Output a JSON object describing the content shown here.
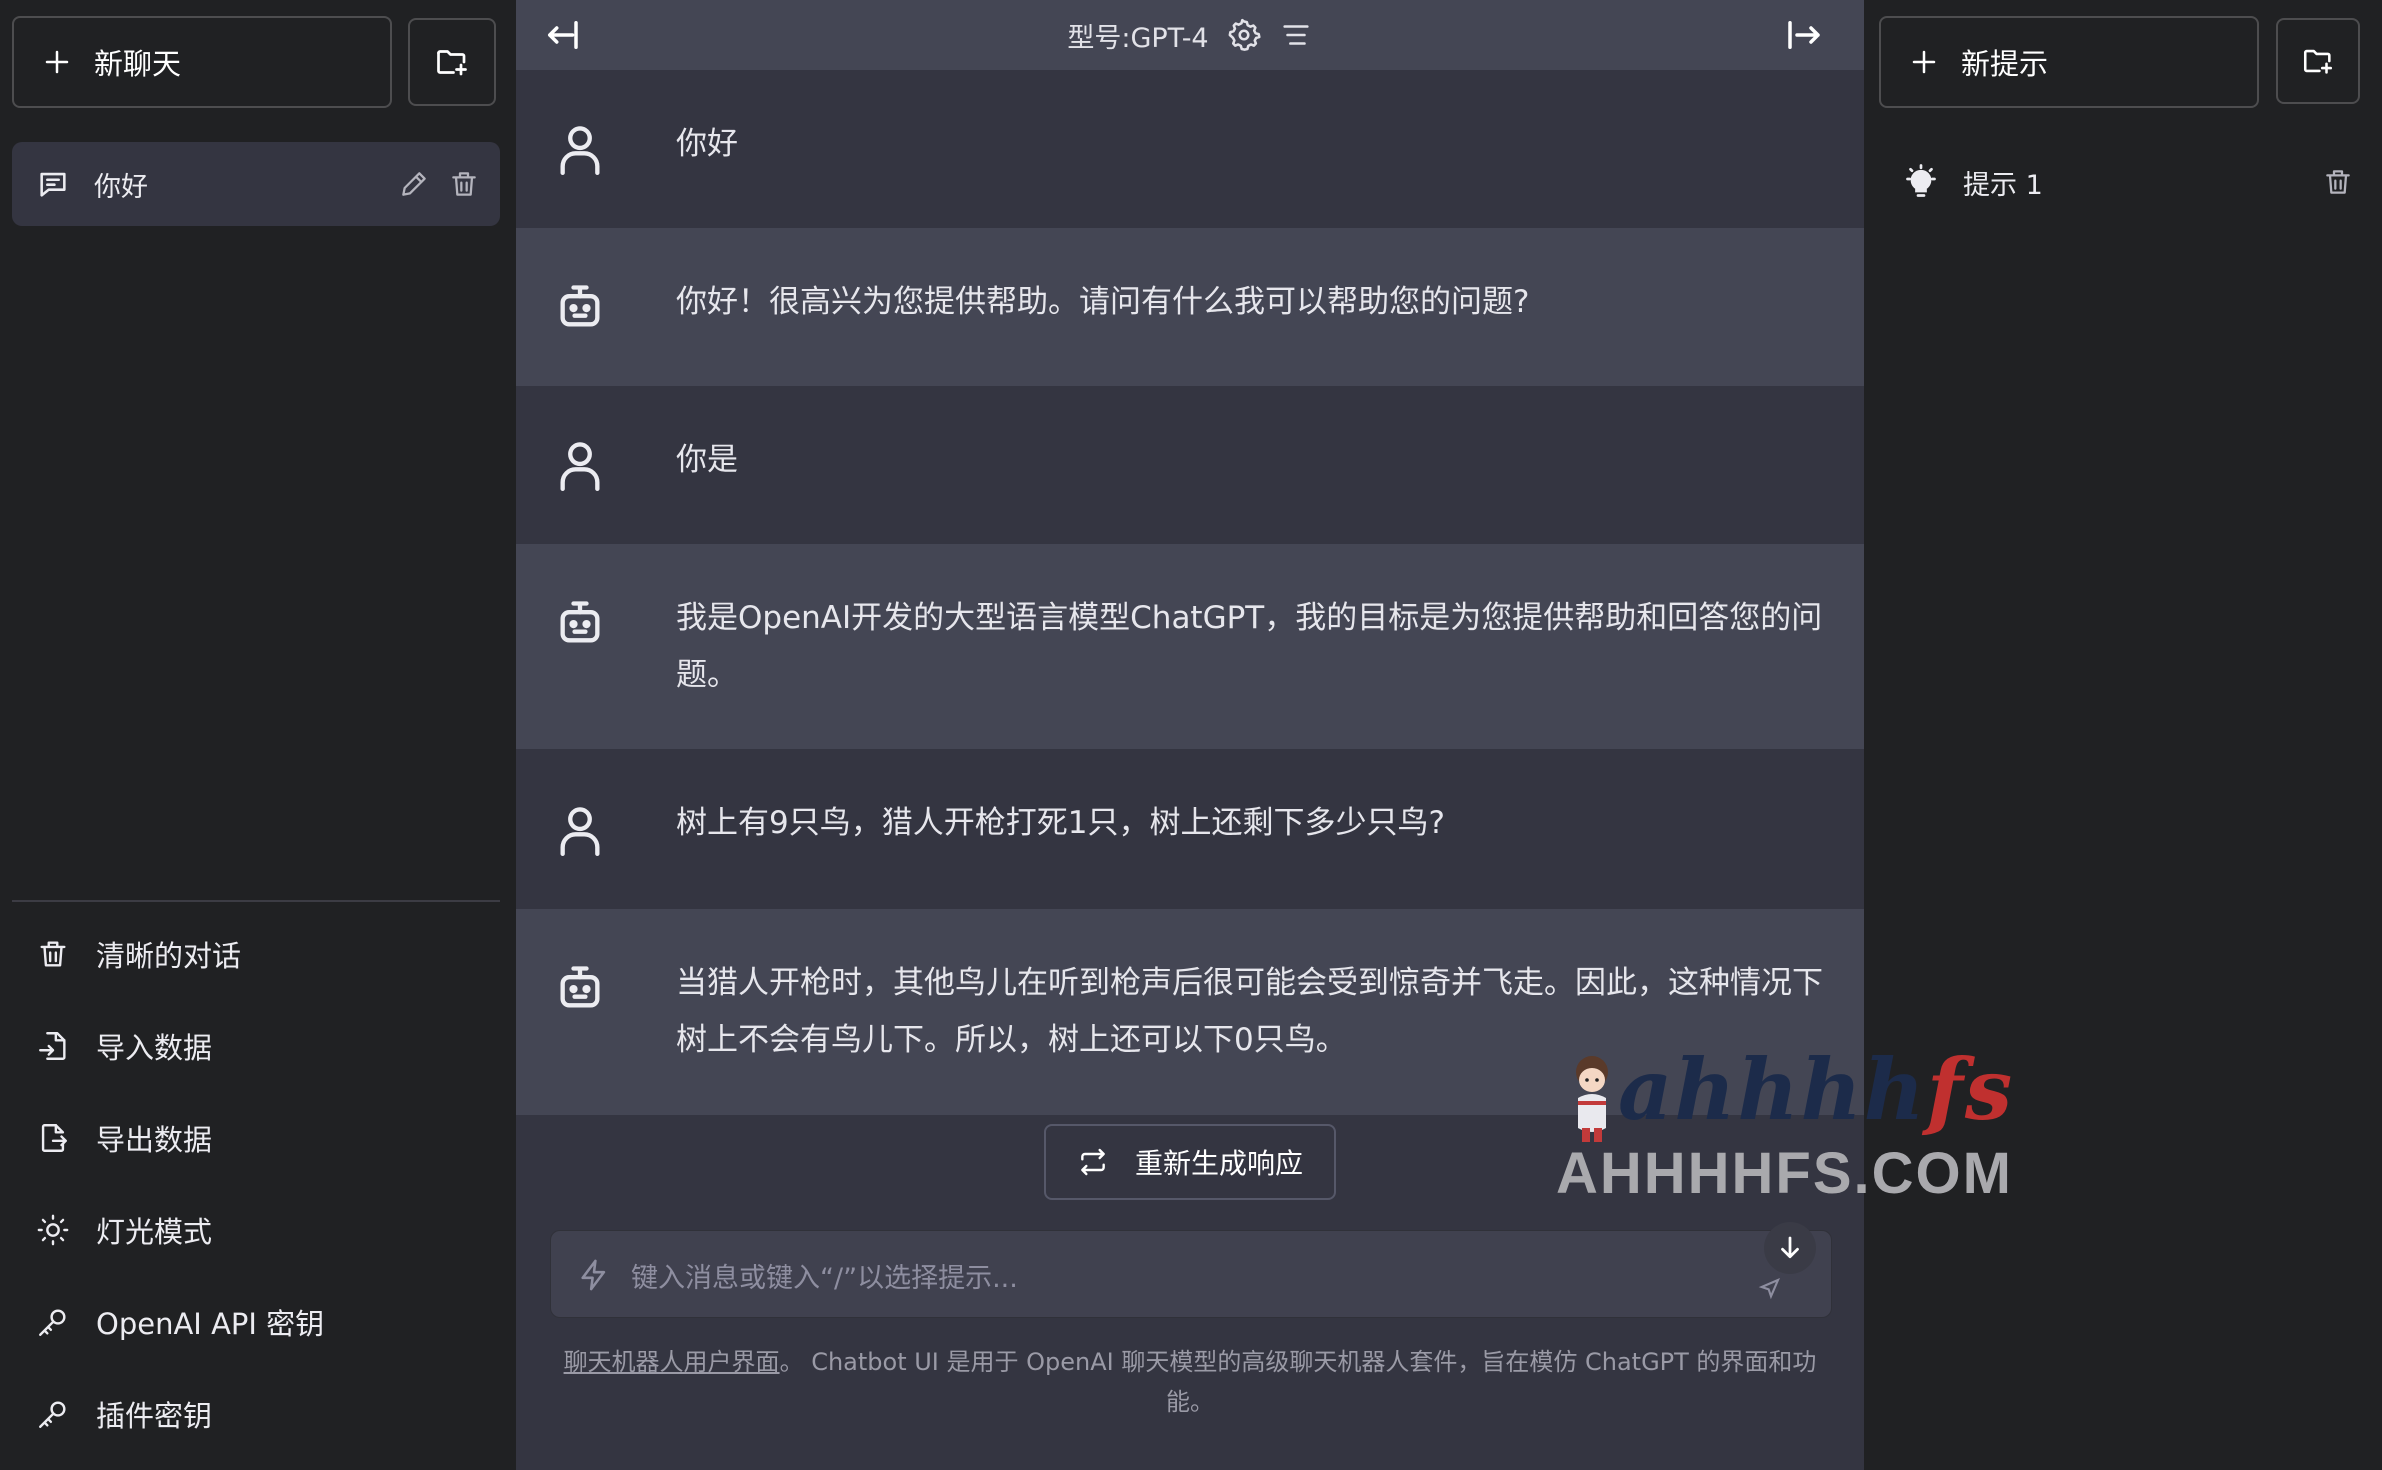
{
  "left_sidebar": {
    "new_chat_label": "新聊天",
    "conversations": [
      {
        "label": "你好"
      }
    ],
    "menu": [
      {
        "label": "清晰的对话",
        "icon": "trash-icon"
      },
      {
        "label": "导入数据",
        "icon": "file-import-icon"
      },
      {
        "label": "导出数据",
        "icon": "file-export-icon"
      },
      {
        "label": "灯光模式",
        "icon": "sun-icon"
      },
      {
        "label": "OpenAI API 密钥",
        "icon": "key-icon"
      },
      {
        "label": "插件密钥",
        "icon": "key-icon"
      }
    ]
  },
  "header": {
    "model_label": "型号:GPT-4"
  },
  "messages": [
    {
      "role": "user",
      "text": "你好"
    },
    {
      "role": "assistant",
      "text": "你好！很高兴为您提供帮助。请问有什么我可以帮助您的问题?"
    },
    {
      "role": "user",
      "text": "你是"
    },
    {
      "role": "assistant",
      "text": "我是OpenAI开发的大型语言模型ChatGPT，我的目标是为您提供帮助和回答您的问题。"
    },
    {
      "role": "user",
      "text": "树上有9只鸟，猎人开枪打死1只，树上还剩下多少只鸟?"
    },
    {
      "role": "assistant",
      "text": "当猎人开枪时，其他鸟儿在听到枪声后很可能会受到惊奇并飞走。因此，这种情况下树上不会有鸟儿下。所以，树上还可以下0只鸟。"
    }
  ],
  "regenerate_label": "重新生成响应",
  "input": {
    "placeholder": "键入消息或键入“/”以选择提示..."
  },
  "footer": {
    "link_text": "聊天机器人用户界面",
    "text": "。 Chatbot UI 是用于 OpenAI 聊天模型的高级聊天机器人套件，旨在模仿 ChatGPT 的界面和功能。"
  },
  "right_sidebar": {
    "new_prompt_label": "新提示",
    "prompts": [
      {
        "label": "提示 1"
      }
    ]
  },
  "watermark": {
    "script_text": "ahhhhfs",
    "domain_text": "AHHHHFS.COM"
  }
}
